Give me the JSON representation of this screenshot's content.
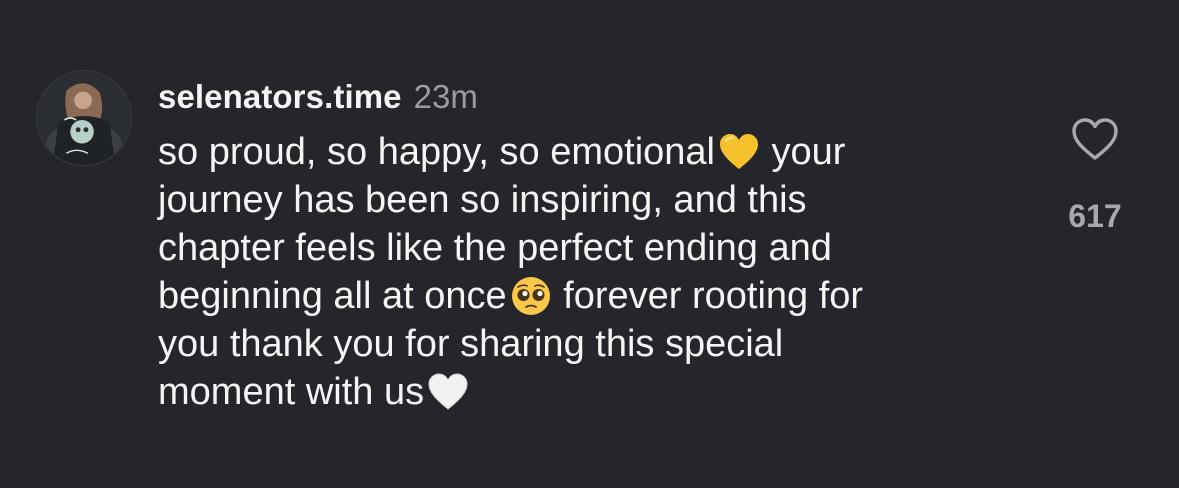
{
  "comment": {
    "username": "selenators.time",
    "timestamp": "23m",
    "avatar_icon": "profile-avatar",
    "lines": [
      {
        "text": "so proud, so happy, so emotional",
        "emoji": "yellow-heart-icon",
        "after": " your"
      },
      {
        "text": "journey has been so inspiring, and this",
        "emoji": "",
        "after": ""
      },
      {
        "text": "chapter feels like the perfect ending and",
        "emoji": "",
        "after": ""
      },
      {
        "text": "beginning all at once",
        "emoji": "pleading-face-icon",
        "after": " forever rooting for"
      },
      {
        "text": "you thank you for sharing this special",
        "emoji": "",
        "after": ""
      },
      {
        "text": "moment with us",
        "emoji": "white-heart-icon",
        "after": ""
      }
    ]
  },
  "like": {
    "icon": "heart-outline-icon",
    "count": "617"
  },
  "colors": {
    "background": "#24262c",
    "text": "#f5f5f5",
    "muted": "#9a9ca3",
    "like_count": "#a5a8ae",
    "yellow_heart": "#f7c12e"
  }
}
